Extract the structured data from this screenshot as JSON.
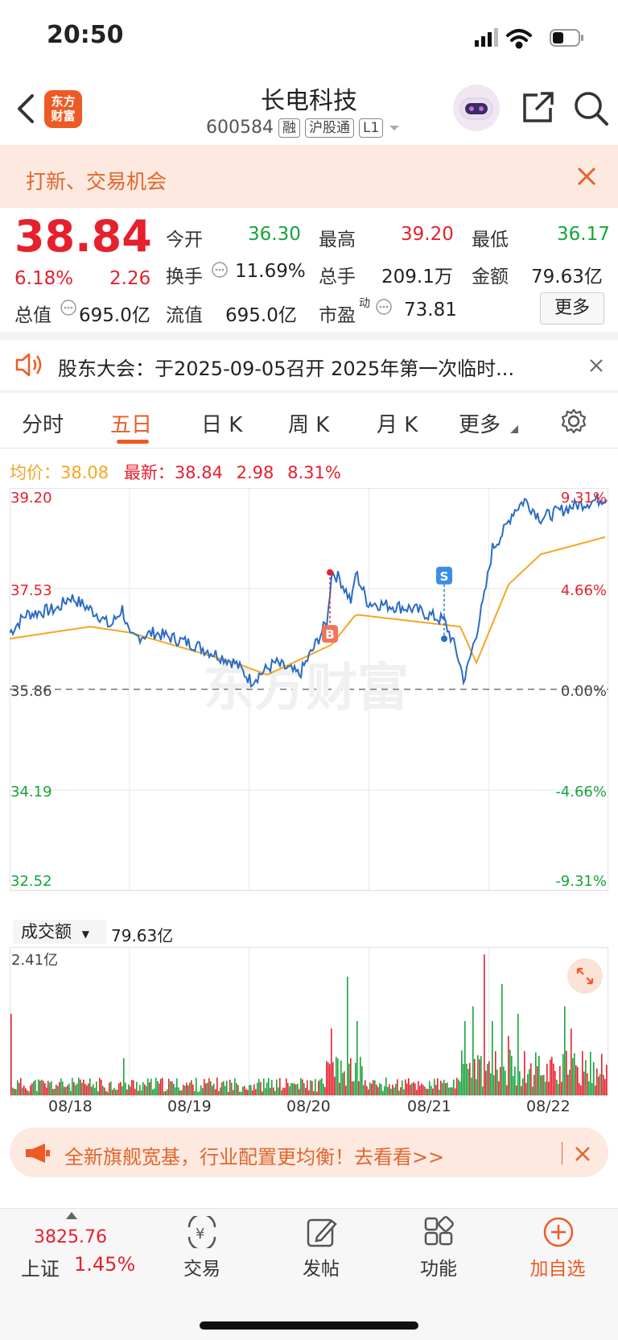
{
  "status": {
    "time": "20:50"
  },
  "header": {
    "title": "长电科技",
    "code": "600584",
    "tags": [
      "融",
      "沪股通",
      "L1"
    ],
    "logo_text": "东方\n财富"
  },
  "promo": {
    "text": "打新、交易机会"
  },
  "quote": {
    "price": "38.84",
    "change_pct": "6.18%",
    "change": "2.26",
    "open_label": "今开",
    "open": "36.30",
    "high_label": "最高",
    "high": "39.20",
    "low_label": "最低",
    "low": "36.17",
    "turnover_label": "换手",
    "turnover": "11.69%",
    "volume_label": "总手",
    "volume": "209.1万",
    "amount_label": "金额",
    "amount": "79.63亿",
    "mktcap_label": "总值",
    "mktcap": "695.0亿",
    "float_label": "流值",
    "float": "695.0亿",
    "pe_label": "市盈",
    "pe_sup": "动",
    "pe": "73.81",
    "more": "更多"
  },
  "notice": {
    "text": "股东大会：于2025-09-05召开 2025年第一次临时..."
  },
  "tabs": [
    {
      "label": "分时"
    },
    {
      "label": "五日"
    },
    {
      "label": "日 K"
    },
    {
      "label": "周 K"
    },
    {
      "label": "月 K"
    },
    {
      "label": "更多"
    }
  ],
  "info_line": {
    "avg_label": "均价：",
    "avg": "38.08",
    "latest_label": "最新：",
    "latest": "38.84",
    "chg": "2.98",
    "pct": "8.31%"
  },
  "chart_data": [
    {
      "type": "line",
      "series": [
        {
          "name": "",
          "values": []
        },
        {
          "name": "均价",
          "values": []
        }
      ],
      "categories": [
        "08/18",
        "08/19",
        "08/20",
        "08/21",
        "08/22"
      ],
      "y_ticks": [
        "39.20",
        "37.53",
        "35.86",
        "34.19",
        "32.52"
      ],
      "y_ticks_right": [
        "9.31%",
        "4.66%",
        "0.00%",
        "-4.66%",
        "-9.31%"
      ],
      "ylim": [
        32.52,
        39.2
      ],
      "prev_close": 35.86,
      "markers": [
        {
          "label": "B"
        },
        {
          "label": "S"
        }
      ],
      "colors": {
        "price": "#2b6cc4",
        "avg": "#f5a623",
        "up": "#e5212e",
        "down": "#16a53b"
      }
    },
    {
      "type": "bar",
      "title": "成交额",
      "total": "79.63亿",
      "ymax_label": "2.41亿",
      "categories": [
        "08/18",
        "08/19",
        "08/20",
        "08/21",
        "08/22"
      ]
    }
  ],
  "banner": {
    "text": "全新旗舰宽基，行业配置更均衡！去看看>>"
  },
  "bottom": {
    "index_value": "3825.76",
    "index_name": "上证",
    "index_pct": "1.45%",
    "items": [
      {
        "label": "交易"
      },
      {
        "label": "发帖"
      },
      {
        "label": "功能"
      },
      {
        "label": "加自选"
      }
    ]
  }
}
